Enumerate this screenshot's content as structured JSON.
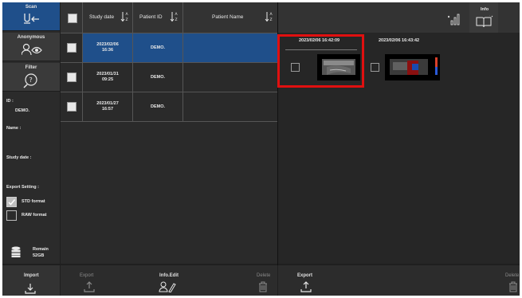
{
  "sidebar": {
    "scan_label": "Scan",
    "anonymous_label": "Anonymous",
    "filter_label": "Filter",
    "id_label": "ID :",
    "id_value": "DEMO.",
    "name_label": "Name :",
    "study_date_label": "Study date :",
    "export_setting_label": "Export Setting :",
    "std_format_label": "STD format",
    "std_format_checked": true,
    "raw_format_label": "RAW format",
    "raw_format_checked": false,
    "remain_label": "Remain",
    "remain_value": "52GB"
  },
  "table": {
    "columns": [
      "Study date",
      "Patient ID",
      "Patient Name"
    ],
    "rows": [
      {
        "date": "2023/02/06",
        "time": "16:36",
        "id": "DEMO.",
        "name": "",
        "selected": true
      },
      {
        "date": "2023/01/31",
        "time": "09:25",
        "id": "DEMO.",
        "name": "",
        "selected": false
      },
      {
        "date": "2023/01/27",
        "time": "16:57",
        "id": "DEMO.",
        "name": "",
        "selected": false
      }
    ]
  },
  "right_panel": {
    "info_label": "Info",
    "thumbnails": [
      {
        "timestamp": "2023/02/06 16:42:09",
        "highlighted": true
      },
      {
        "timestamp": "2023/02/06 16:43:42",
        "highlighted": false
      }
    ]
  },
  "bottom_left": {
    "import_label": "Import",
    "export_label": "Export",
    "info_edit_label": "Info.Edit",
    "delete_label": "Delete"
  },
  "bottom_right": {
    "export_label": "Export",
    "delete_label": "Delete"
  },
  "colors": {
    "accent_blue": "#1f4f8a",
    "highlight_red": "#e01010",
    "background": "#1f1f1f"
  }
}
